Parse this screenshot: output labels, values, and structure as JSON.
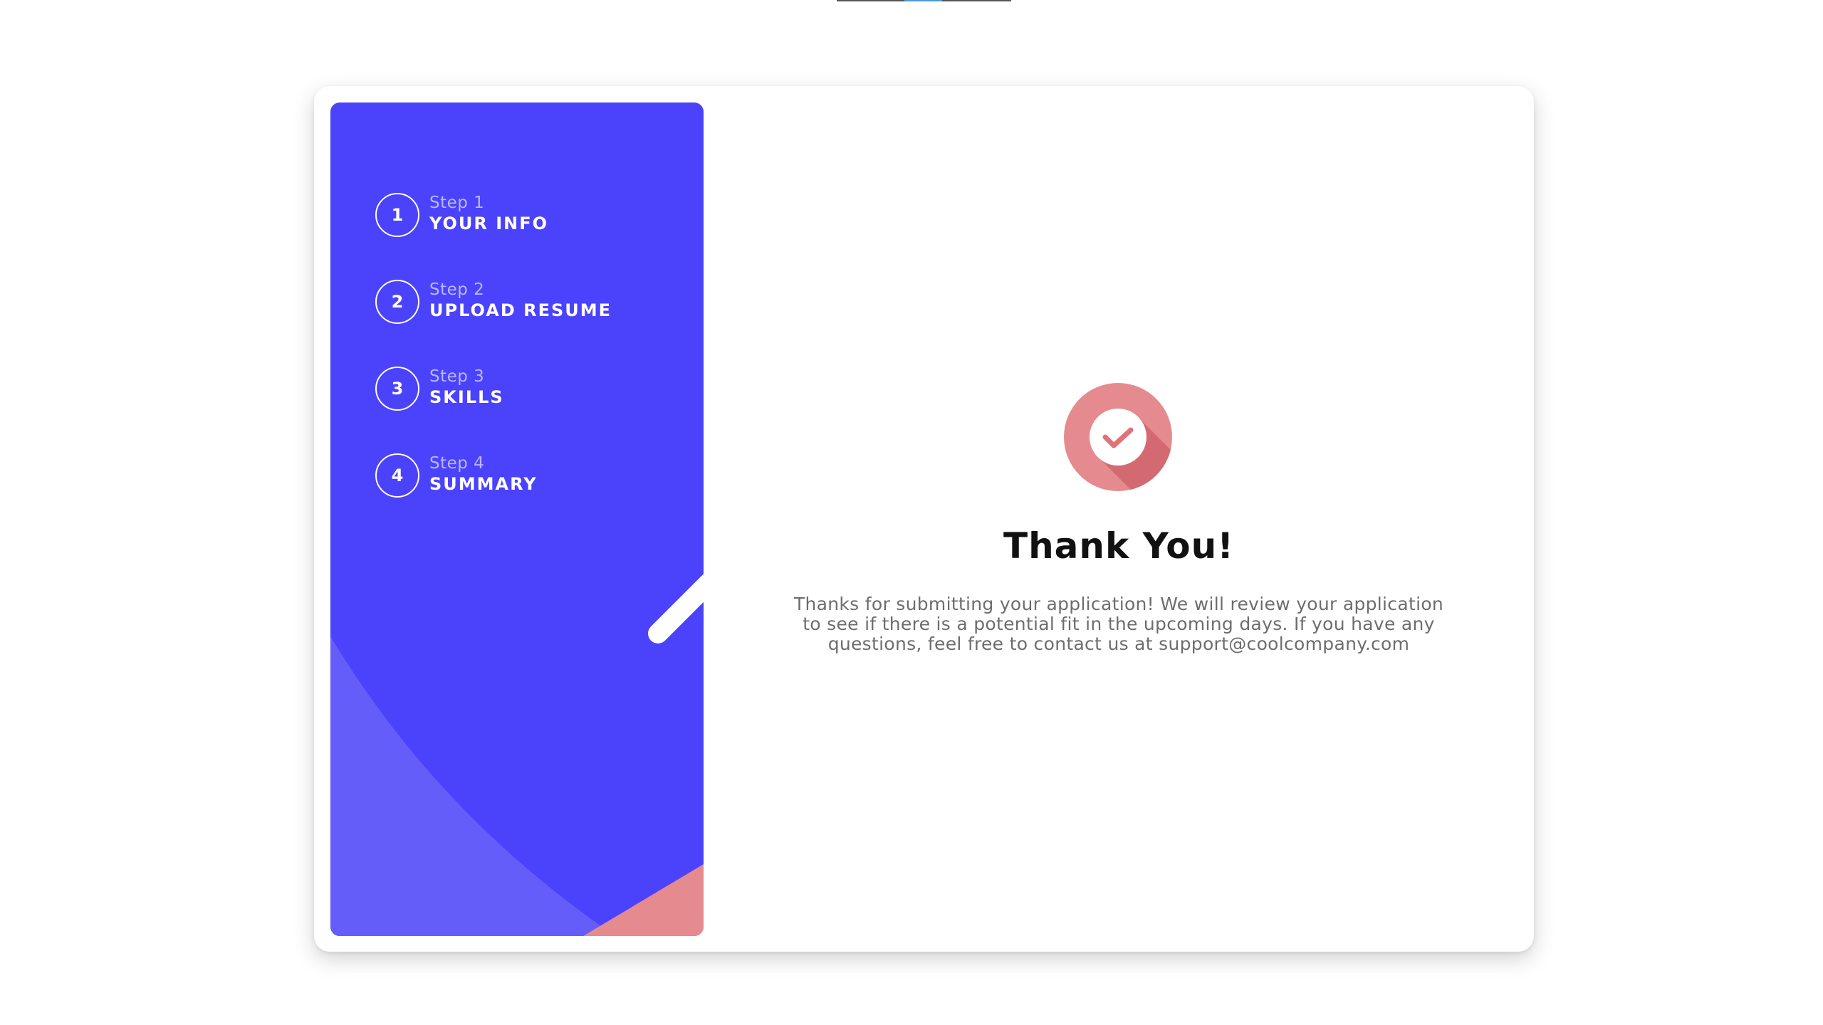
{
  "steps": [
    {
      "number": "1",
      "label": "Step 1",
      "title": "YOUR INFO"
    },
    {
      "number": "2",
      "label": "Step 2",
      "title": "UPLOAD RESUME"
    },
    {
      "number": "3",
      "label": "Step 3",
      "title": "SKILLS"
    },
    {
      "number": "4",
      "label": "Step 4",
      "title": "SUMMARY"
    }
  ],
  "confirmation": {
    "icon": "check-icon",
    "title": "Thank You!",
    "message": "Thanks for submitting your application! We will review your application to see if there is a potential fit in the upcoming days. If you have any questions, feel free to contact us at support@coolcompany.com"
  },
  "colors": {
    "sidebar": "#4b43fb",
    "sidebar_light": "#655dfa",
    "accent": "#e58a8e",
    "step_label": "#b9b6ff",
    "message_text": "#6d6d6d"
  }
}
